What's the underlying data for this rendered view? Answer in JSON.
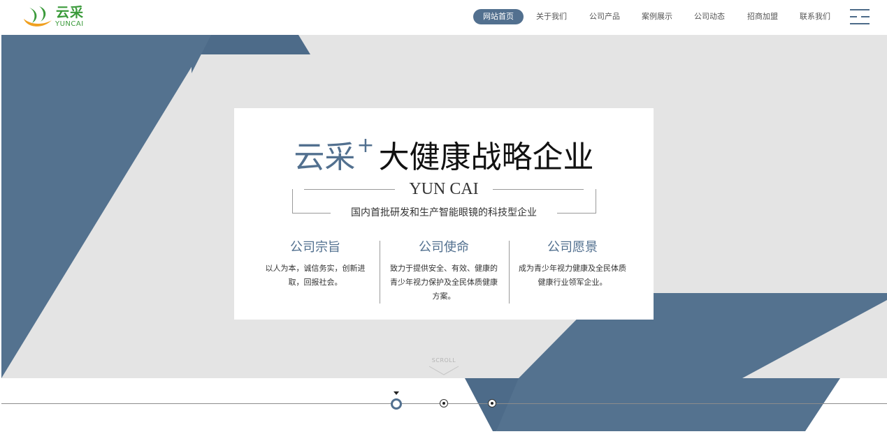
{
  "brand": {
    "logo_cn": "云采",
    "logo_en": "YUNCAI",
    "logo_color": "#3a9a3a",
    "logo_accent": "#f0a020"
  },
  "nav": {
    "items": [
      {
        "label": "网站首页",
        "active": true
      },
      {
        "label": "关于我们",
        "active": false
      },
      {
        "label": "公司产品",
        "active": false
      },
      {
        "label": "案例展示",
        "active": false
      },
      {
        "label": "公司动态",
        "active": false
      },
      {
        "label": "招商加盟",
        "active": false
      },
      {
        "label": "联系我们",
        "active": false
      }
    ],
    "menu_icon": "menu-icon"
  },
  "hero": {
    "title_brand": "云采",
    "title_plus": "+",
    "title_rest": "大健康战略企业",
    "subtitle_en": "YUN CAI",
    "subtitle_cn": "国内首批研发和生产智能眼镜的科技型企业",
    "columns": [
      {
        "title": "公司宗旨",
        "text": "以人为本，诚信务实，创新进取，回报社会。"
      },
      {
        "title": "公司使命",
        "text": "致力于提供安全、有效、健康的青少年视力保护及全民体质健康方案。"
      },
      {
        "title": "公司愿景",
        "text": "成为青少年视力健康及全民体质健康行业领军企业。"
      }
    ]
  },
  "scroll": {
    "label": "SCROLL"
  },
  "timeline": {
    "active_index": 0,
    "count": 3
  },
  "colors": {
    "accent": "#52708f",
    "hero_bg": "#e4e4e4",
    "shape_dark": "#4d6b89",
    "shape_main": "#54728f"
  }
}
